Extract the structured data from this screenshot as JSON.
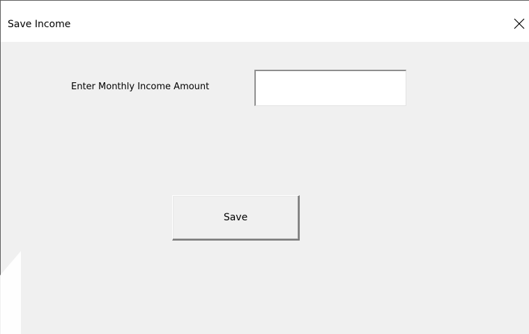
{
  "window": {
    "title": "Save Income",
    "close_glyph": "close-icon"
  },
  "form": {
    "income_label": "Enter Monthly Income Amount",
    "income_value": "",
    "income_placeholder": "",
    "save_label": "Save"
  },
  "colors": {
    "client_background": "#f0f0f0",
    "title_background": "#ffffff",
    "text": "#000000"
  }
}
